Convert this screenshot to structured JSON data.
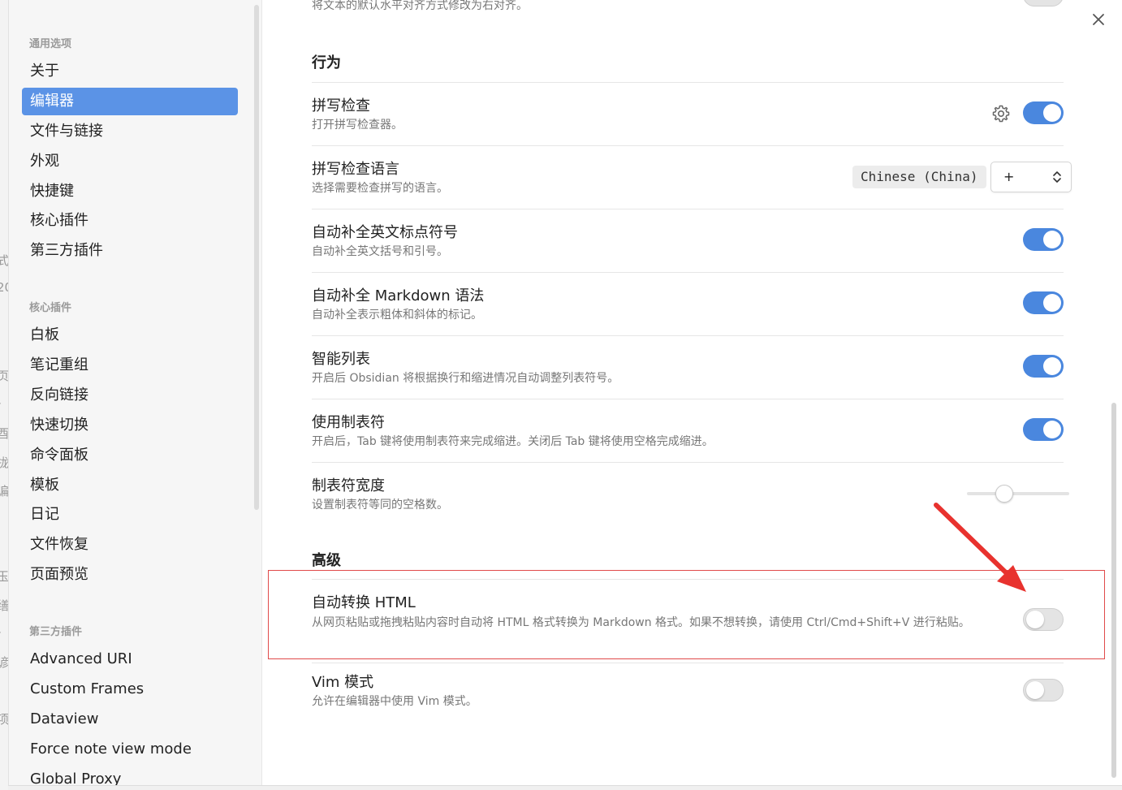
{
  "edge_fragments": [
    "式",
    "20",
    "页",
    "-",
    "酉",
    "拢",
    "谝",
    "玉",
    "缮",
    "-",
    "谚",
    "项"
  ],
  "sidebar": {
    "groups": [
      {
        "title": "通用选项",
        "items": [
          "关于",
          "编辑器",
          "文件与链接",
          "外观",
          "快捷键",
          "核心插件",
          "第三方插件"
        ]
      },
      {
        "title": "核心插件",
        "items": [
          "白板",
          "笔记重组",
          "反向链接",
          "快速切换",
          "命令面板",
          "模板",
          "日记",
          "文件恢复",
          "页面预览"
        ]
      },
      {
        "title": "第三方插件",
        "items": [
          "Advanced URI",
          "Custom Frames",
          "Dataview",
          "Force note view mode",
          "Global Proxy"
        ]
      }
    ],
    "active_item": "编辑器"
  },
  "content": {
    "top_partial_desc": "将文本的默认水平对齐方式修改为右对齐。",
    "sections": [
      {
        "title": "行为",
        "settings": [
          {
            "name": "拼写检查",
            "desc": "打开拼写检查器。",
            "control": "toggle",
            "on": true,
            "has_gear": true
          },
          {
            "name": "拼写检查语言",
            "desc": "选择需要检查拼写的语言。",
            "control": "language",
            "tag": "Chinese (China)",
            "select_value": "+"
          },
          {
            "name": "自动补全英文标点符号",
            "desc": "自动补全英文括号和引号。",
            "control": "toggle",
            "on": true
          },
          {
            "name": "自动补全 Markdown 语法",
            "desc": "自动补全表示粗体和斜体的标记。",
            "control": "toggle",
            "on": true
          },
          {
            "name": "智能列表",
            "desc": "开启后 Obsidian 将根据换行和缩进情况自动调整列表符号。",
            "control": "toggle",
            "on": true
          },
          {
            "name": "使用制表符",
            "desc": "开启后，Tab 键将使用制表符来完成缩进。关闭后 Tab 键将使用空格完成缩进。",
            "control": "toggle",
            "on": true
          },
          {
            "name": "制表符宽度",
            "desc": "设置制表符等同的空格数。",
            "control": "slider",
            "value_fraction": 0.36
          }
        ]
      },
      {
        "title": "高级",
        "settings": [
          {
            "name": "自动转换 HTML",
            "desc": "从网页粘贴或拖拽粘贴内容时自动将 HTML 格式转换为 Markdown 格式。如果不想转换，请使用 Ctrl/Cmd+Shift+V 进行粘贴。",
            "control": "toggle",
            "on": false,
            "highlighted": true
          },
          {
            "name": "Vim 模式",
            "desc": "允许在编辑器中使用 Vim 模式。",
            "control": "toggle",
            "on": false
          }
        ]
      }
    ]
  },
  "colors": {
    "accent": "#4a87de",
    "sidebar_active": "#5b93e6",
    "annotation": "#e8322e"
  },
  "icons": {
    "close": "close-icon",
    "gear": "gear-icon",
    "chevron": "chevron-updown-icon"
  }
}
